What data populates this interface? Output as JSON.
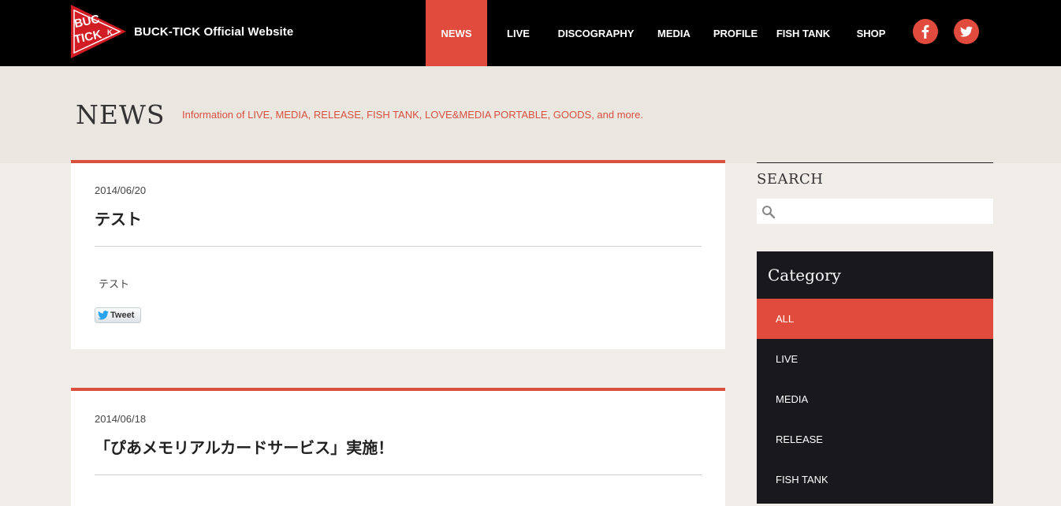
{
  "header": {
    "logo_text": "BUCK-TICK",
    "site_title": "BUCK-TICK Official Website",
    "nav": [
      {
        "label": "NEWS",
        "active": true
      },
      {
        "label": "LIVE",
        "active": false
      },
      {
        "label": "DISCOGRAPHY",
        "active": false
      },
      {
        "label": "MEDIA",
        "active": false
      },
      {
        "label": "PROFILE",
        "active": false
      },
      {
        "label": "FISH TANK",
        "active": false
      },
      {
        "label": "SHOP",
        "active": false
      }
    ],
    "social": [
      {
        "icon": "facebook-icon"
      },
      {
        "icon": "twitter-icon"
      }
    ]
  },
  "banner": {
    "title": "NEWS",
    "subtitle": "Information of LIVE, MEDIA, RELEASE, FISH TANK, LOVE&MEDIA PORTABLE, GOODS, and more."
  },
  "posts": [
    {
      "date": "2014/06/20",
      "title": "テスト",
      "body": "テスト",
      "tweet_label": "Tweet"
    },
    {
      "date": "2014/06/18",
      "title": "「ぴあメモリアルカードサービス」実施！"
    }
  ],
  "sidebar": {
    "search": {
      "title": "SEARCH",
      "placeholder": "",
      "icon": "search-icon"
    },
    "category": {
      "title": "Category",
      "items": [
        {
          "label": "ALL",
          "active": true
        },
        {
          "label": "LIVE",
          "active": false
        },
        {
          "label": "MEDIA",
          "active": false
        },
        {
          "label": "RELEASE",
          "active": false
        },
        {
          "label": "FISH TANK",
          "active": false
        }
      ]
    }
  },
  "colors": {
    "accent": "#e14b3e",
    "header_bg": "#000000",
    "banner_bg": "#eae6e0",
    "page_bg": "#f1eeea",
    "category_bg": "#19181c"
  }
}
